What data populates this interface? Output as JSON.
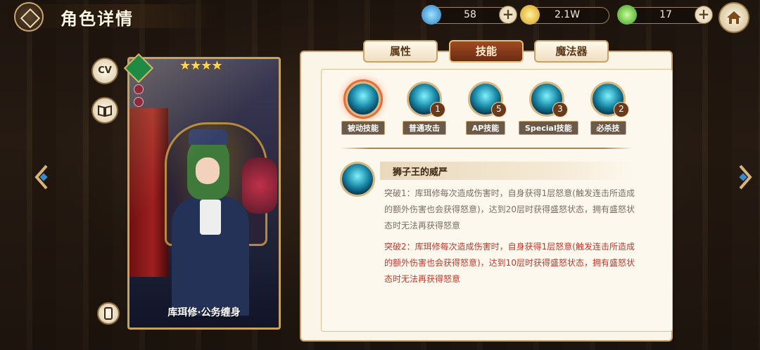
{
  "header": {
    "title": "角色详情"
  },
  "resources": [
    {
      "name": "wings",
      "icon": "blue-wing-icon",
      "value": "58",
      "color": "#3aa7e8"
    },
    {
      "name": "gold",
      "icon": "gold-coin-icon",
      "value": "2.1W",
      "color": "#f2c23a"
    },
    {
      "name": "crystal",
      "icon": "green-crystal-icon",
      "value": "17",
      "color": "#5cc63e"
    }
  ],
  "side_buttons": {
    "cv_label": "CV"
  },
  "character": {
    "name": "库珥修·公务缠身",
    "stars": "★★★★",
    "rarity": 4
  },
  "tabs": [
    {
      "label": "属性",
      "active": false
    },
    {
      "label": "技能",
      "active": true
    },
    {
      "label": "魔法器",
      "active": false
    }
  ],
  "skills": [
    {
      "label": "被动技能",
      "level": "",
      "selected": true
    },
    {
      "label": "普通攻击",
      "level": "1",
      "selected": false
    },
    {
      "label": "AP技能",
      "level": "5",
      "selected": false
    },
    {
      "label": "Special技能",
      "level": "3",
      "selected": false
    },
    {
      "label": "必杀技",
      "level": "2",
      "selected": false
    }
  ],
  "detail": {
    "name": "狮子王的威严",
    "break1": "突破1：库珥修每次造成伤害时，自身获得1层怒意(触发连击所造成的额外伤害也会获得怒意)，达到20层时获得盛怒状态，拥有盛怒状态时无法再获得怒意",
    "break2": "突破2：库珥修每次造成伤害时，自身获得1层怒意(触发连击所造成的额外伤害也会获得怒意)，达到10层时获得盛怒状态，拥有盛怒状态时无法再获得怒意"
  }
}
